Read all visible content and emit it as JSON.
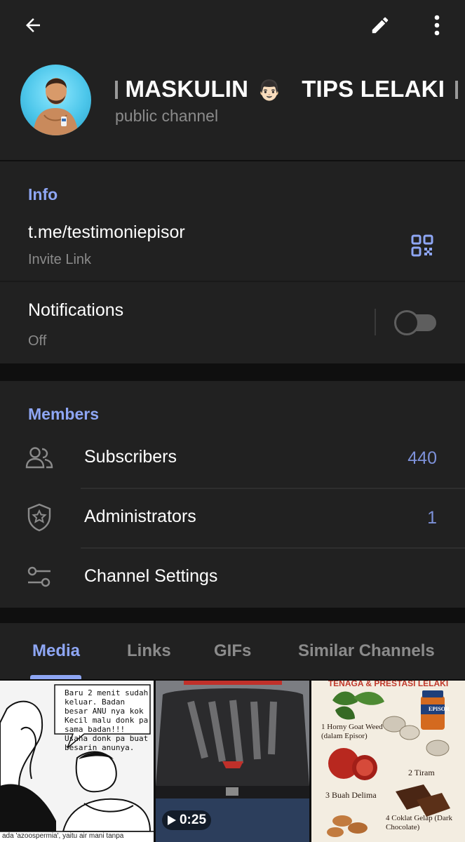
{
  "header": {
    "back_icon": "arrow-left-icon",
    "edit_icon": "pencil-icon",
    "more_icon": "more-vertical-icon",
    "title_left": "MASKULIN",
    "title_emoji": "👨🏻",
    "title_right": "TIPS LELAKI",
    "subtitle": "public channel"
  },
  "info": {
    "section_title": "Info",
    "link": "t.me/testimoniepisor",
    "link_caption": "Invite Link",
    "qr_icon": "qr-code-icon",
    "notifications_label": "Notifications",
    "notifications_value": "Off",
    "notifications_enabled": false
  },
  "members": {
    "section_title": "Members",
    "items": [
      {
        "label": "Subscribers",
        "count": "440",
        "icon": "people-icon"
      },
      {
        "label": "Administrators",
        "count": "1",
        "icon": "shield-star-icon"
      },
      {
        "label": "Channel Settings",
        "count": "",
        "icon": "sliders-icon"
      }
    ]
  },
  "tabs": [
    {
      "label": "Media",
      "active": true
    },
    {
      "label": "Links",
      "active": false
    },
    {
      "label": "GIFs",
      "active": false
    },
    {
      "label": "Similar Channels",
      "active": false
    }
  ],
  "media": {
    "thumb1_text": "Baru 2 menit sudah keluar. Badan besar ANU nya kok Kecil malu donk pa sama badan!!! Usaha donk pa buat besarin anunya.",
    "thumb1_caption": "ada 'azoospermia', yaitu air mani tanpa",
    "video_duration": "0:25",
    "thumb3_header": "TENAGA & PRESTASI LELAKI",
    "thumb3_items": [
      "1 Horny Goat Weed (dalam Episor)",
      "2 Tiram",
      "3 Buah Delima",
      "4 Coklat Gelap (Dark Chocolate)"
    ],
    "thumb3_bottle": "EPISOR"
  },
  "colors": {
    "accent": "#8ea6f4",
    "count": "#7d91d9",
    "panel": "#212121",
    "background": "#0f0f0f",
    "secondary_text": "#8b8b8b"
  }
}
